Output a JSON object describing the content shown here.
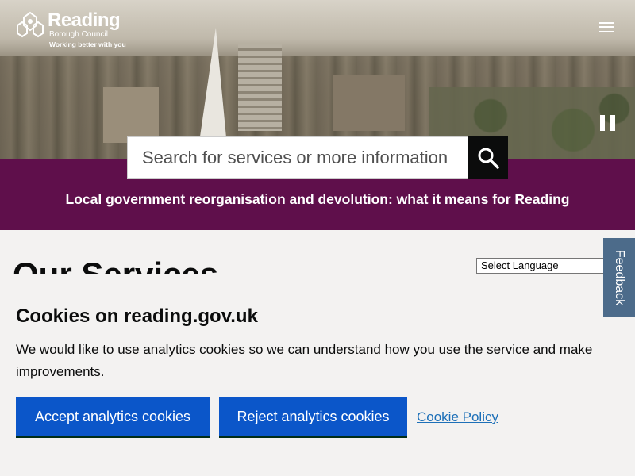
{
  "header": {
    "logo_title": "Reading",
    "logo_subtitle": "Borough Council",
    "logo_tagline": "Working better with you",
    "menu_icon": "hamburger-menu-icon",
    "pause_icon": "pause-icon"
  },
  "search": {
    "placeholder": "Search for services or more information",
    "button_icon": "search-icon"
  },
  "banner": {
    "link_text": "Local government reorganisation and devolution: what it means for Reading",
    "color": "#5f0f4b"
  },
  "main": {
    "title": "Our Services",
    "language_select": "Select Language"
  },
  "feedback": {
    "label": "Feedback"
  },
  "cookies": {
    "heading": "Cookies on reading.gov.uk",
    "body": "We would like to use analytics cookies so we can understand how you use the service and make improvements.",
    "accept_label": "Accept analytics cookies",
    "reject_label": "Reject analytics cookies",
    "policy_link": "Cookie Policy",
    "button_color": "#0b56c9"
  }
}
